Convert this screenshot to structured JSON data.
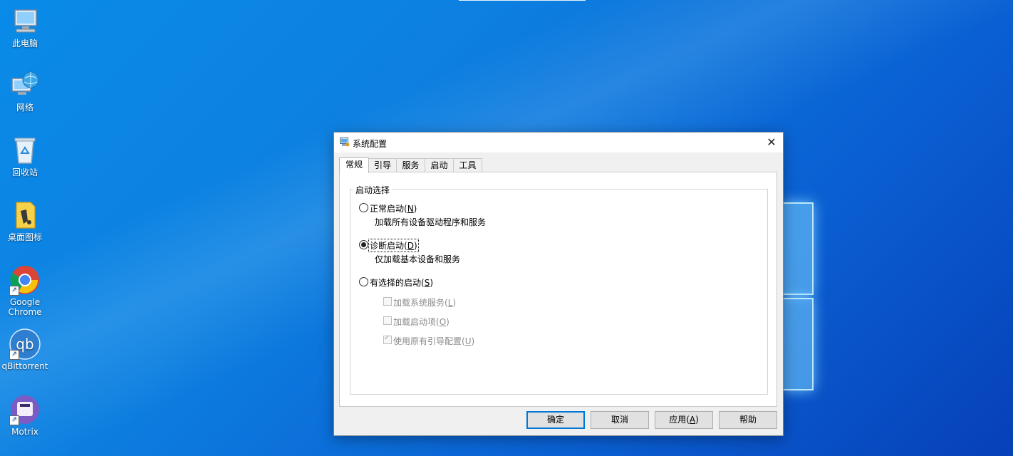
{
  "desktop": {
    "icons": [
      {
        "label": "此电脑"
      },
      {
        "label": "网络"
      },
      {
        "label": "回收站"
      },
      {
        "label": "桌面图标"
      },
      {
        "label": "Google Chrome"
      },
      {
        "label": "qBittorrent"
      },
      {
        "label": "Motrix"
      }
    ]
  },
  "dialog": {
    "title": "系统配置",
    "close": "✕",
    "tabs": [
      {
        "label": "常规",
        "active": true
      },
      {
        "label": "引导"
      },
      {
        "label": "服务"
      },
      {
        "label": "启动"
      },
      {
        "label": "工具"
      }
    ],
    "group_title": "启动选择",
    "options": [
      {
        "label": "正常启动(",
        "key": "N",
        "end": ")",
        "desc": "加载所有设备驱动程序和服务",
        "selected": false
      },
      {
        "label": "诊断启动(",
        "key": "D",
        "end": ")",
        "desc": "仅加载基本设备和服务",
        "selected": true
      },
      {
        "label": "有选择的启动(",
        "key": "S",
        "end": ")",
        "selected": false
      }
    ],
    "checkboxes": [
      {
        "label": "加载系统服务(",
        "key": "L",
        "end": ")",
        "checked": false
      },
      {
        "label": "加载启动项(",
        "key": "O",
        "end": ")",
        "checked": false
      },
      {
        "label": "使用原有引导配置(",
        "key": "U",
        "end": ")",
        "checked": true
      }
    ],
    "buttons": {
      "ok": "确定",
      "cancel": "取消",
      "apply_label": "应用(",
      "apply_key": "A",
      "apply_end": ")",
      "help": "帮助"
    }
  }
}
